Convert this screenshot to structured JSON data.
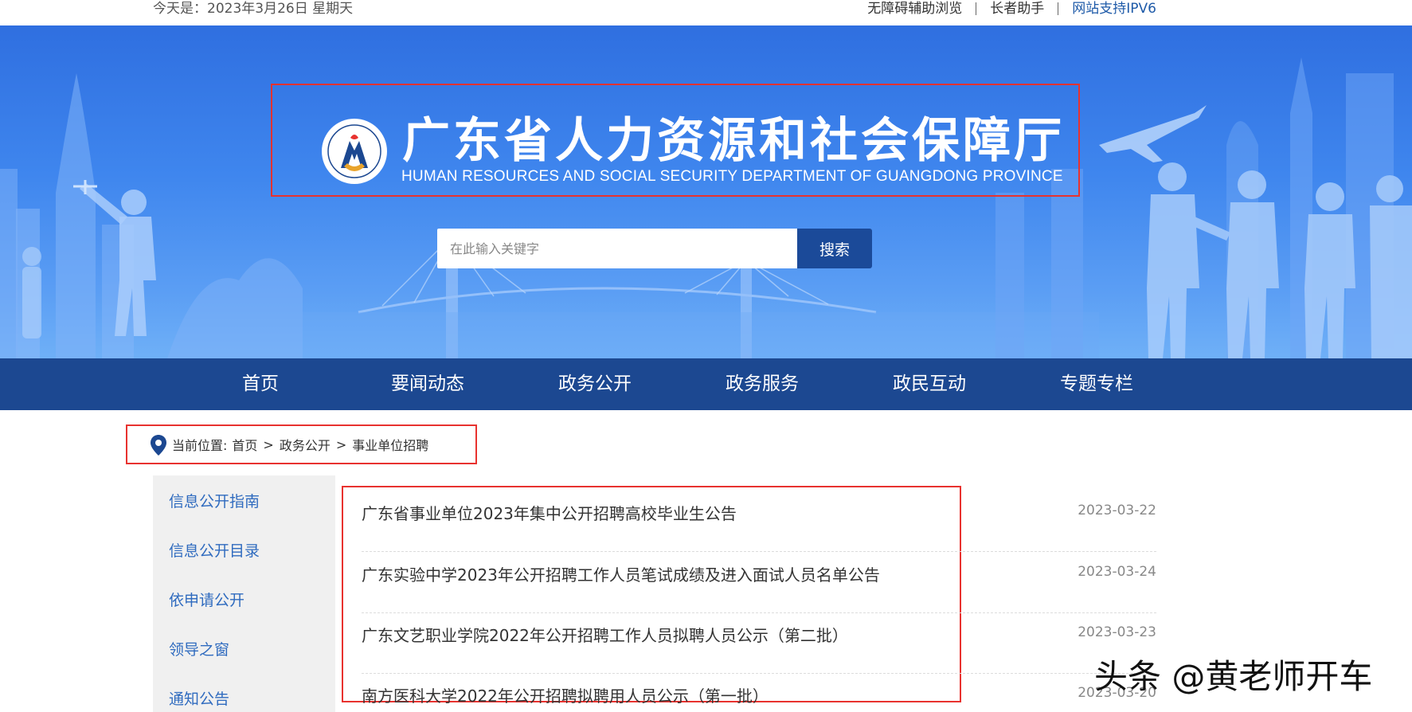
{
  "topbar": {
    "date": "今天是：2023年3月26日 星期天",
    "links": [
      "无障碍辅助浏览",
      "长者助手",
      "网站支持IPV6"
    ]
  },
  "header": {
    "title_cn": "广东省人力资源和社会保障厅",
    "title_en": "HUMAN RESOURCES AND SOCIAL SECURITY DEPARTMENT OF GUANGDONG PROVINCE"
  },
  "search": {
    "placeholder": "在此输入关键字",
    "button": "搜索"
  },
  "nav": {
    "items": [
      "首页",
      "要闻动态",
      "政务公开",
      "政务服务",
      "政民互动",
      "专题专栏"
    ]
  },
  "breadcrumb": {
    "prefix": "当前位置:",
    "items": [
      "首页",
      "政务公开",
      "事业单位招聘"
    ],
    "separator": ">"
  },
  "sidebar": {
    "items": [
      "信息公开指南",
      "信息公开目录",
      "依申请公开",
      "领导之窗",
      "通知公告"
    ]
  },
  "articles": [
    {
      "title": "广东省事业单位2023年集中公开招聘高校毕业生公告",
      "date": "2023-03-22"
    },
    {
      "title": "广东实验中学2023年公开招聘工作人员笔试成绩及进入面试人员名单公告",
      "date": "2023-03-24"
    },
    {
      "title": "广东文艺职业学院2022年公开招聘工作人员拟聘人员公示（第二批）",
      "date": "2023-03-23"
    },
    {
      "title": "南方医科大学2022年公开招聘拟聘用人员公示（第一批）",
      "date": "2023-03-20"
    }
  ],
  "watermark": "头条 @黄老师开车",
  "colors": {
    "nav_bg": "#1c4891",
    "search_button": "#1b4a99",
    "link_blue": "#2f6bbf",
    "highlight_red": "#e8322f"
  }
}
